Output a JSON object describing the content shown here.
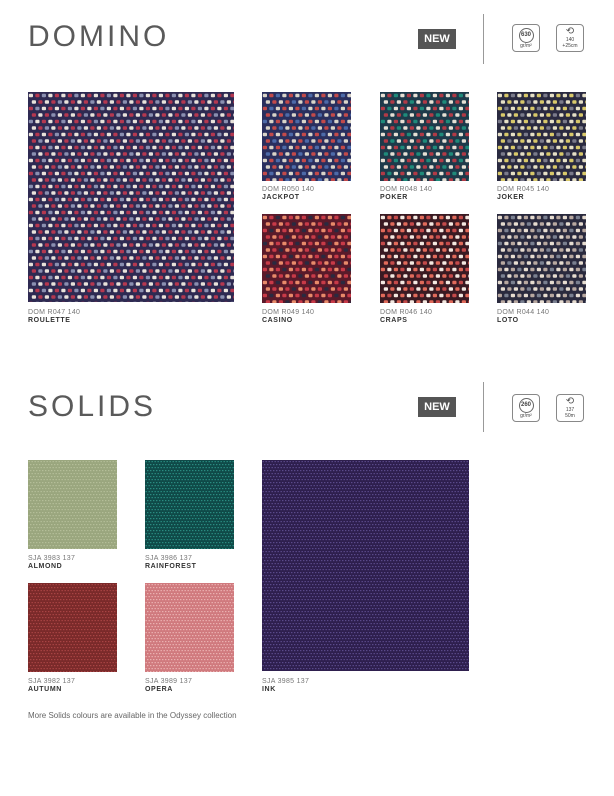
{
  "domino": {
    "title": "DOMINO",
    "badge": "NEW",
    "icons": {
      "weight_icon": "weight-icon",
      "weight_value": "630",
      "weight_unit": "gr/m²",
      "width_icon": "roll-width-icon",
      "width_value": "140",
      "width_note": "+25cm"
    },
    "swatches": [
      {
        "code": "DOM R047 140",
        "name": "ROULETTE",
        "colors": {
          "base": "#2e2a52",
          "a": "#e8e2da",
          "b": "#b43850",
          "c": "#8a8fb0"
        }
      },
      {
        "code": "DOM R050 140",
        "name": "JACKPOT",
        "colors": {
          "base": "#2a2f5e",
          "a": "#d9d4c8",
          "b": "#c24a4a",
          "c": "#4d6aa8"
        }
      },
      {
        "code": "DOM R048 140",
        "name": "POKER",
        "colors": {
          "base": "#1e3a4a",
          "a": "#e6e0d4",
          "b": "#b03a46",
          "c": "#1f8a7a"
        }
      },
      {
        "code": "DOM R045 140",
        "name": "JOKER",
        "colors": {
          "base": "#2a2a40",
          "a": "#e6e0c6",
          "b": "#d8c86a",
          "c": "#7a7a8a"
        }
      },
      {
        "code": "DOM R049 140",
        "name": "CASINO",
        "colors": {
          "base": "#5a1a2a",
          "a": "#e88a6a",
          "b": "#c83a48",
          "c": "#2a2a40"
        }
      },
      {
        "code": "DOM R046 140",
        "name": "CRAPS",
        "colors": {
          "base": "#3a1a22",
          "a": "#f3e8e0",
          "b": "#e06a5a",
          "c": "#c44a4a"
        }
      },
      {
        "code": "DOM R044 140",
        "name": "LOTO",
        "colors": {
          "base": "#2a2a3e",
          "a": "#e6dcd0",
          "b": "#b8a8a0",
          "c": "#7a8090"
        }
      }
    ]
  },
  "solids": {
    "title": "SOLIDS",
    "badge": "NEW",
    "icons": {
      "weight_icon": "weight-icon",
      "weight_value": "260",
      "weight_unit": "gr/m²",
      "width_icon": "roll-width-icon",
      "width_value": "137",
      "width_note": "50m"
    },
    "swatches": [
      {
        "code": "SJA 3983 137",
        "name": "ALMOND",
        "colors": {
          "base": "#9aa67e",
          "dot": "#b4bd98"
        }
      },
      {
        "code": "SJA 3986 137",
        "name": "RAINFOREST",
        "colors": {
          "base": "#0f4a48",
          "dot": "#2a8a80"
        }
      },
      {
        "code": "SJA 3985 137",
        "name": "INK",
        "colors": {
          "base": "#2e1f4e",
          "dot": "#5a4a8a"
        }
      },
      {
        "code": "SJA 3982 137",
        "name": "AUTUMN",
        "colors": {
          "base": "#7a2a2a",
          "dot": "#a84444"
        }
      },
      {
        "code": "SJA 3989 137",
        "name": "OPERA",
        "colors": {
          "base": "#d07a7e",
          "dot": "#eab0b0"
        }
      }
    ],
    "footnote": "More Solids colours are available in the Odyssey collection"
  }
}
